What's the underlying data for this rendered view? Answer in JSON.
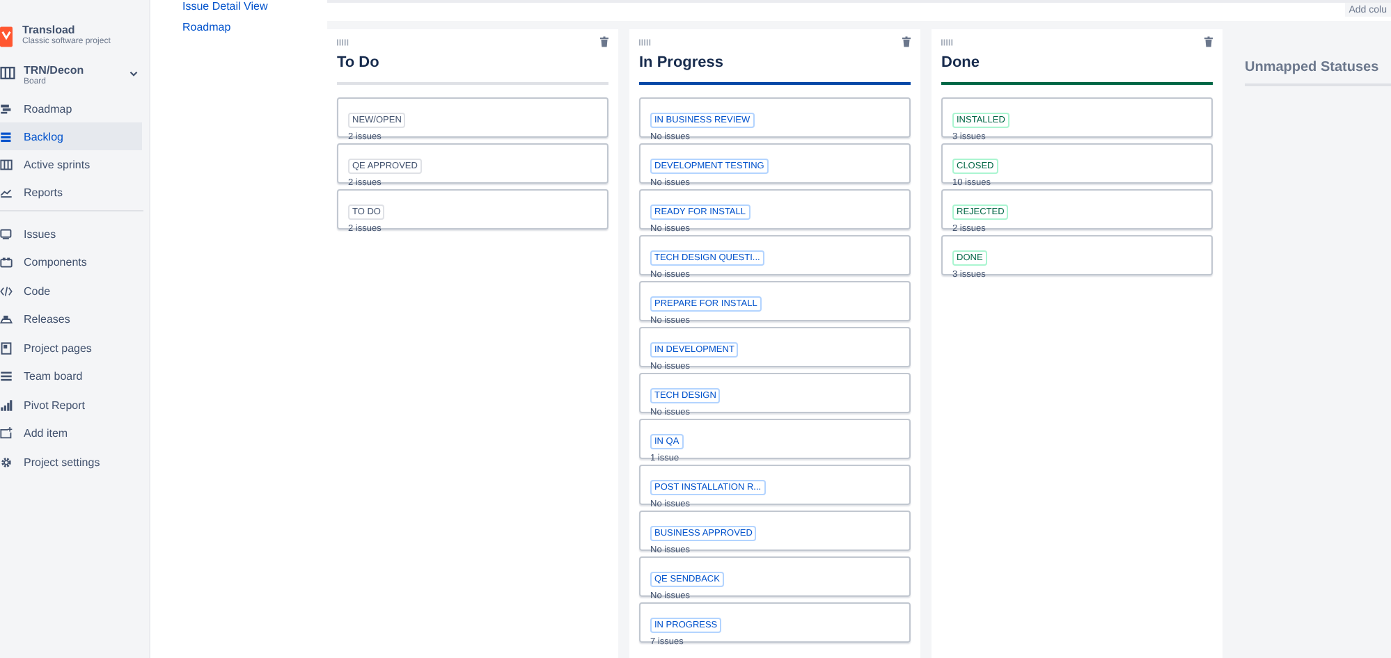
{
  "sidebar": {
    "project": {
      "name": "Transload",
      "type": "Classic software project"
    },
    "board": {
      "name": "TRN/Decon",
      "type": "Board"
    },
    "groups": [
      [
        {
          "label": "Roadmap",
          "selected": false
        },
        {
          "label": "Backlog",
          "selected": true
        },
        {
          "label": "Active sprints",
          "selected": false
        },
        {
          "label": "Reports",
          "selected": false
        }
      ],
      [
        {
          "label": "Issues",
          "selected": false
        },
        {
          "label": "Components",
          "selected": false
        },
        {
          "label": "Code",
          "selected": false
        },
        {
          "label": "Releases",
          "selected": false
        },
        {
          "label": "Project pages",
          "selected": false
        },
        {
          "label": "Team board",
          "selected": false
        },
        {
          "label": "Pivot Report",
          "selected": false
        },
        {
          "label": "Add item",
          "selected": false
        },
        {
          "label": "Project settings",
          "selected": false
        }
      ]
    ]
  },
  "settings_nav": [
    "Issue Detail View",
    "Roadmap"
  ],
  "add_column_button": "Add colu",
  "columns": [
    {
      "title": "To Do",
      "kind": "todo",
      "statuses": [
        {
          "name": "NEW/OPEN",
          "count": "2 issues"
        },
        {
          "name": "QE APPROVED",
          "count": "2 issues"
        },
        {
          "name": "TO DO",
          "count": "2 issues"
        }
      ]
    },
    {
      "title": "In Progress",
      "kind": "inprogress",
      "statuses": [
        {
          "name": "IN BUSINESS REVIEW",
          "count": "No issues"
        },
        {
          "name": "DEVELOPMENT TESTING",
          "count": "No issues"
        },
        {
          "name": "READY FOR INSTALL",
          "count": "No issues"
        },
        {
          "name": "TECH DESIGN QUESTI...",
          "count": "No issues"
        },
        {
          "name": "PREPARE FOR INSTALL",
          "count": "No issues"
        },
        {
          "name": "IN DEVELOPMENT",
          "count": "No issues"
        },
        {
          "name": "TECH DESIGN",
          "count": "No issues"
        },
        {
          "name": "IN QA",
          "count": "1 issue"
        },
        {
          "name": "POST INSTALLATION R...",
          "count": "No issues"
        },
        {
          "name": "BUSINESS APPROVED",
          "count": "No issues"
        },
        {
          "name": "QE SENDBACK",
          "count": "No issues"
        },
        {
          "name": "IN PROGRESS",
          "count": "7 issues"
        }
      ]
    },
    {
      "title": "Done",
      "kind": "done",
      "statuses": [
        {
          "name": "INSTALLED",
          "count": "3 issues"
        },
        {
          "name": "CLOSED",
          "count": "10 issues"
        },
        {
          "name": "REJECTED",
          "count": "2 issues"
        },
        {
          "name": "DONE",
          "count": "3 issues"
        }
      ]
    }
  ],
  "unmapped": {
    "title": "Unmapped Statuses"
  }
}
